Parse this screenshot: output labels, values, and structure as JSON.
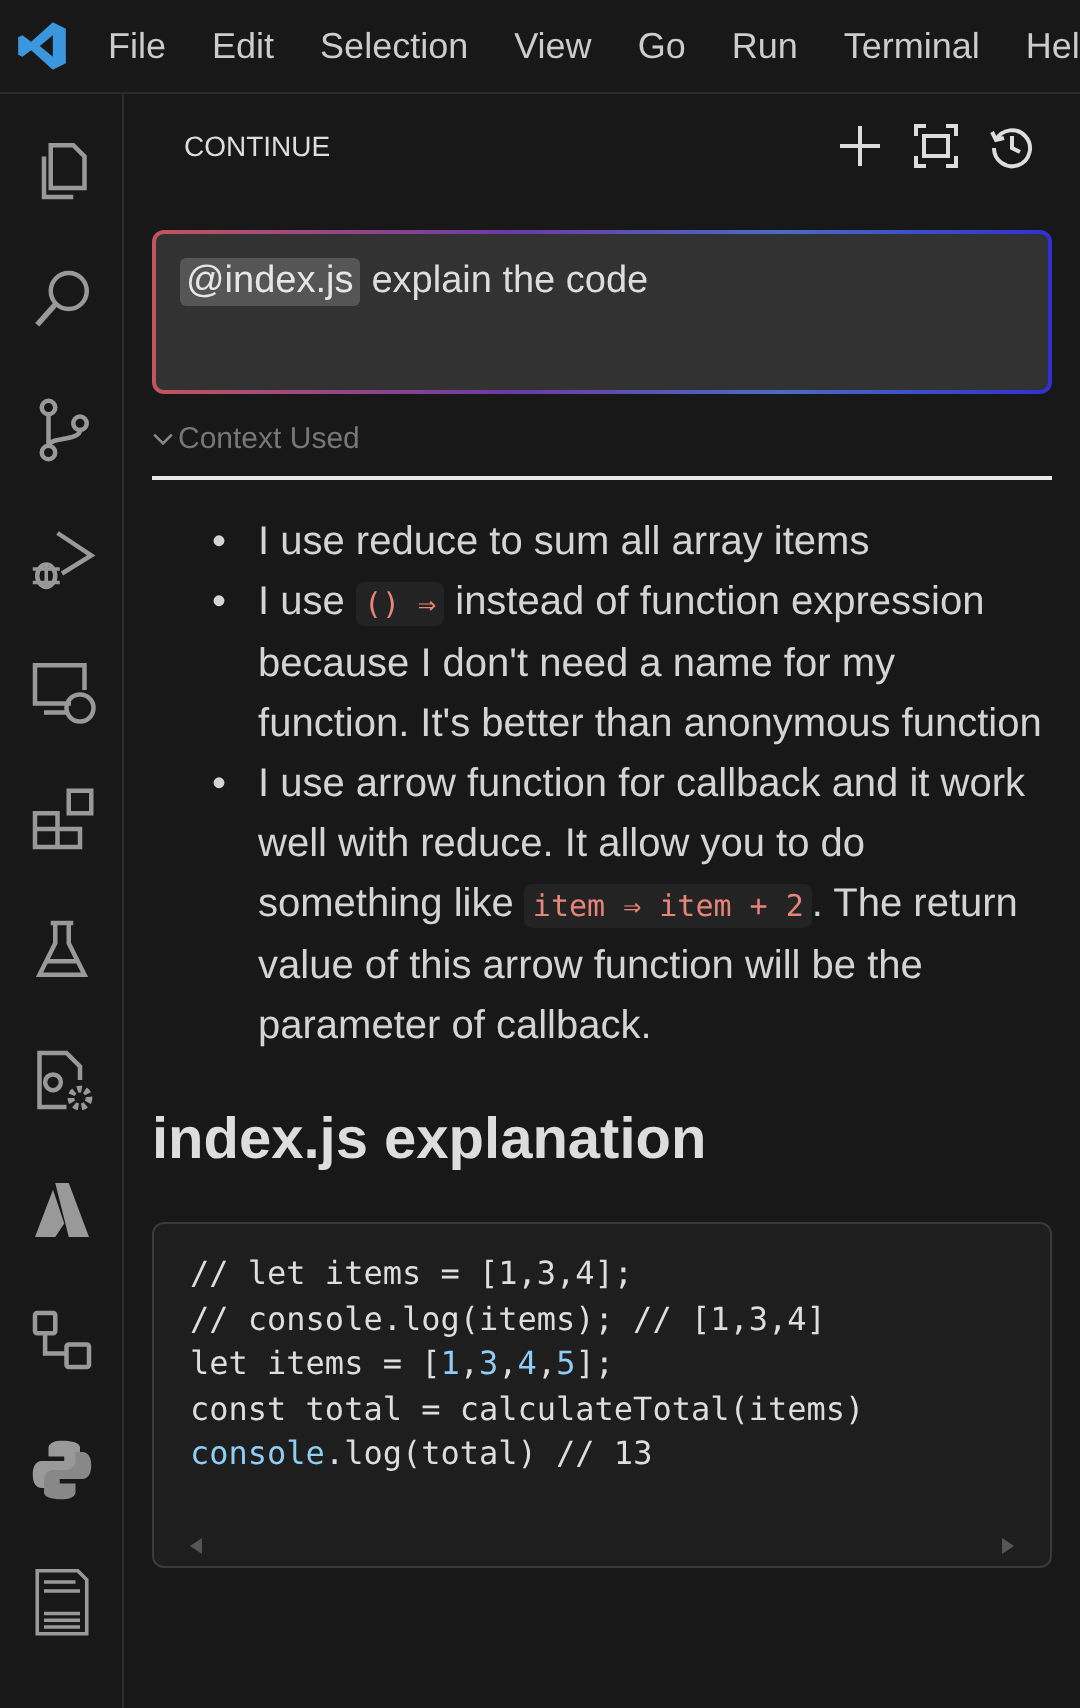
{
  "menu": [
    "File",
    "Edit",
    "Selection",
    "View",
    "Go",
    "Run",
    "Terminal",
    "Hel"
  ],
  "panel": {
    "title": "CONTINUE"
  },
  "prompt": {
    "mention": "@index.js",
    "value": "explain the code"
  },
  "context": {
    "label": "Context Used"
  },
  "bullets": [
    {
      "marker": "•",
      "segments": [
        {
          "kind": "text",
          "text": "I use reduce to sum all array items"
        }
      ]
    },
    {
      "marker": "•",
      "segments": [
        {
          "kind": "text",
          "text": "I use "
        },
        {
          "kind": "code",
          "text": "() ⇒"
        },
        {
          "kind": "text",
          "text": " instead of function expression because I don't need a name for my function. It's better than anonymous function"
        }
      ]
    },
    {
      "marker": "•",
      "segments": [
        {
          "kind": "text",
          "text": "I use arrow function for callback and it work well with reduce. It allow you to do something like "
        },
        {
          "kind": "code",
          "text": "item ⇒ item + 2"
        },
        {
          "kind": "text",
          "text": ". The return value of this arrow function will be the parameter of callback."
        }
      ]
    }
  ],
  "heading": "index.js explanation",
  "code": [
    [
      {
        "kind": "plain",
        "text": "// let items = [1,3,4];"
      }
    ],
    [
      {
        "kind": "plain",
        "text": "// console.log(items); // [1,3,4]"
      }
    ],
    [
      {
        "kind": "plain",
        "text": "let items = ["
      },
      {
        "kind": "number",
        "text": "1"
      },
      {
        "kind": "plain",
        "text": ","
      },
      {
        "kind": "number",
        "text": "3"
      },
      {
        "kind": "plain",
        "text": ","
      },
      {
        "kind": "number",
        "text": "4"
      },
      {
        "kind": "plain",
        "text": ","
      },
      {
        "kind": "number",
        "text": "5"
      },
      {
        "kind": "plain",
        "text": "];"
      }
    ],
    [
      {
        "kind": "plain",
        "text": "const total = calculateTotal(items)"
      }
    ],
    [
      {
        "kind": "ident",
        "text": "console"
      },
      {
        "kind": "plain",
        "text": ".log(total) // 13"
      }
    ]
  ]
}
